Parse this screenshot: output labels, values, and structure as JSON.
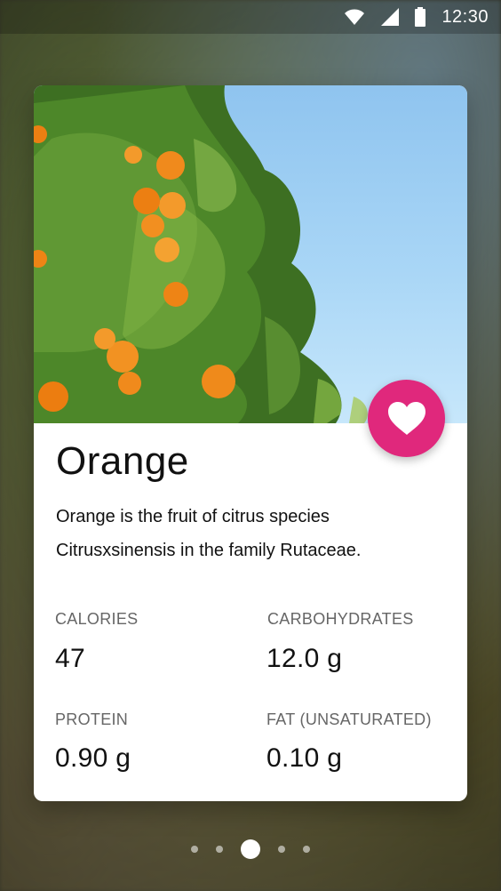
{
  "status_bar": {
    "time": "12:30",
    "icons": [
      "wifi-icon",
      "cell-signal-icon",
      "battery-icon"
    ]
  },
  "card": {
    "title": "Orange",
    "description": "Orange is the fruit of citrus species Citrusxsinensis in the family Rutaceae.",
    "favorite_icon": "heart-icon",
    "accent_color": "#e0287c",
    "stats": [
      {
        "label": "CALORIES",
        "value": "47"
      },
      {
        "label": "CARBOHYDRATES",
        "value": "12.0 g"
      },
      {
        "label": "PROTEIN",
        "value": "0.90 g"
      },
      {
        "label": "FAT (UNSATURATED)",
        "value": "0.10 g"
      }
    ]
  },
  "pager": {
    "count": 5,
    "active_index": 2
  }
}
